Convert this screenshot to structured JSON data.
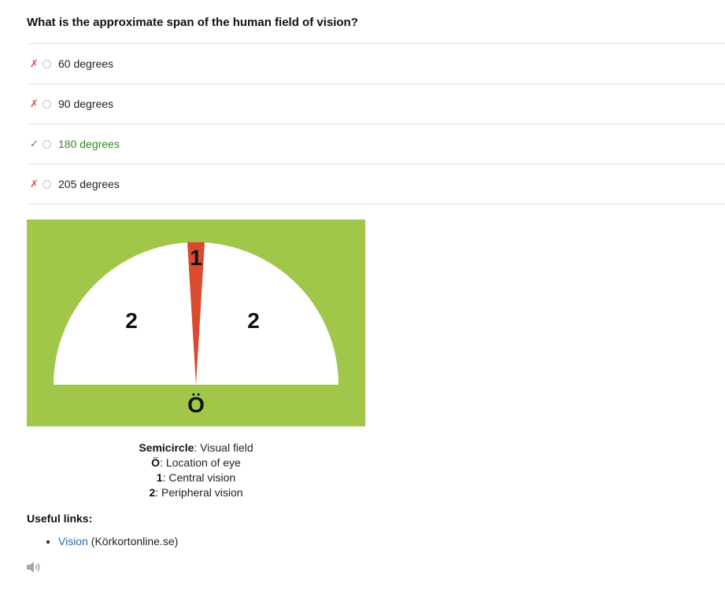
{
  "question": "What is the approximate span of the human field of vision?",
  "answers": [
    {
      "mark": "✗",
      "label": "60 degrees",
      "correct": false
    },
    {
      "mark": "✗",
      "label": "90 degrees",
      "correct": false
    },
    {
      "mark": "✓",
      "label": "180 degrees",
      "correct": true
    },
    {
      "mark": "✗",
      "label": "205 degrees",
      "correct": false
    }
  ],
  "figure": {
    "background_color": "#a0c64a",
    "field_color": "#ffffff",
    "central_color": "#d94a2f",
    "central_label": "1",
    "left_label": "2",
    "right_label": "2",
    "eye_label": "Ö"
  },
  "caption": [
    {
      "term": "Semicircle",
      "desc": ": Visual field"
    },
    {
      "term": "Ö",
      "desc": ": Location of eye"
    },
    {
      "term": "1",
      "desc": ": Central vision"
    },
    {
      "term": "2",
      "desc": ": Peripheral vision"
    }
  ],
  "useful_links": {
    "heading": "Useful links:",
    "items": [
      {
        "link_text": "Vision",
        "source": " (Körkortonline.se)"
      }
    ]
  },
  "audio_icon": "speaker-icon"
}
